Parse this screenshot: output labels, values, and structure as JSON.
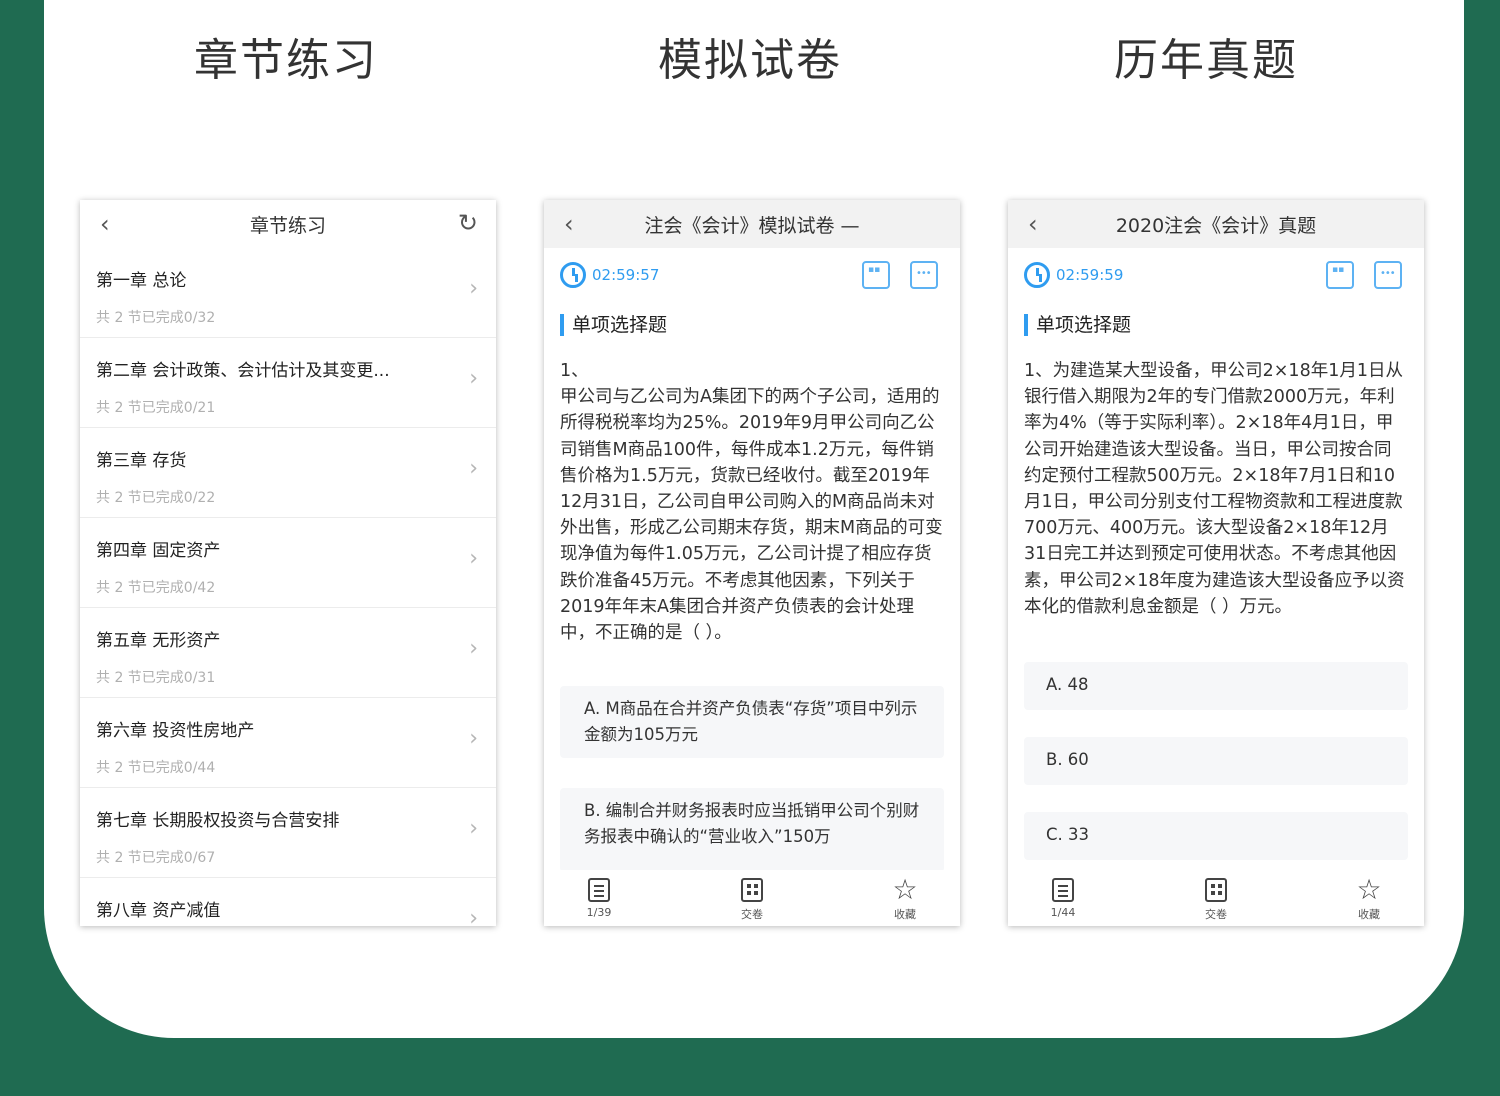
{
  "features": [
    {
      "label": "章节练习",
      "icon": "notebook-icon",
      "color": "#1f7df3"
    },
    {
      "label": "模拟试卷",
      "icon": "paper-icon",
      "color": "#ff6a3d"
    },
    {
      "label": "历年真题",
      "icon": "medal-icon",
      "color": "#ff9f2d"
    }
  ],
  "phone1": {
    "title": "章节练习",
    "chapters": [
      {
        "title": "第一章 总论",
        "sub": "共 2 节已完成0/32"
      },
      {
        "title": "第二章 会计政策、会计估计及其变更...",
        "sub": "共 2 节已完成0/21"
      },
      {
        "title": "第三章 存货",
        "sub": "共 2 节已完成0/22"
      },
      {
        "title": "第四章 固定资产",
        "sub": "共 2 节已完成0/42"
      },
      {
        "title": "第五章 无形资产",
        "sub": "共 2 节已完成0/31"
      },
      {
        "title": "第六章 投资性房地产",
        "sub": "共 2 节已完成0/44"
      },
      {
        "title": "第七章 长期股权投资与合营安排",
        "sub": "共 2 节已完成0/67"
      },
      {
        "title": "第八章 资产减值",
        "sub": ""
      }
    ]
  },
  "phone2": {
    "title": "注会《会计》模拟试卷 —",
    "timer": "02:59:57",
    "section": "单项选择题",
    "question": "1、\n甲公司与乙公司为A集团下的两个子公司，适用的所得税税率均为25%。2019年9月甲公司向乙公司销售M商品100件，每件成本1.2万元，每件销售价格为1.5万元，货款已经收付。截至2019年12月31日，乙公司自甲公司购入的M商品尚未对外出售，形成乙公司期末存货，期末M商品的可变现净值为每件1.05万元，乙公司计提了相应存货跌价准备45万元。不考虑其他因素，下列关于2019年年末A集团合并资产负债表的会计处理中，不正确的是（ ）。",
    "option_a": "A.  M商品在合并资产负债表“存货”项目中列示金额为105万元",
    "option_b": "B.  编制合并财务报表时应当抵销甲公司个别财务报表中确认的“营业收入”150万",
    "tabs": [
      "1/39",
      "交卷",
      "收藏"
    ]
  },
  "phone3": {
    "title": "2020注会《会计》真题",
    "timer": "02:59:59",
    "section": "单项选择题",
    "question": "1、为建造某大型设备，甲公司2×18年1月1日从银行借入期限为2年的专门借款2000万元，年利率为4%（等于实际利率）。2×18年4月1日，甲公司开始建造该大型设备。当日，甲公司按合同约定预付工程款500万元。2×18年7月1日和10月1日，甲公司分别支付工程物资款和工程进度款700万元、400万元。该大型设备2×18年12月31日完工并达到预定可使用状态。不考虑其他因素，甲公司2×18年度为建造该大型设备应予以资本化的借款利息金额是（ ）万元。",
    "options": [
      "A.  48",
      "B.  60",
      "C.  33"
    ],
    "tabs": [
      "1/44",
      "交卷",
      "收藏"
    ]
  },
  "icons": {
    "back": "‹",
    "chevron": "›",
    "refresh": "↻",
    "star": "☆"
  }
}
